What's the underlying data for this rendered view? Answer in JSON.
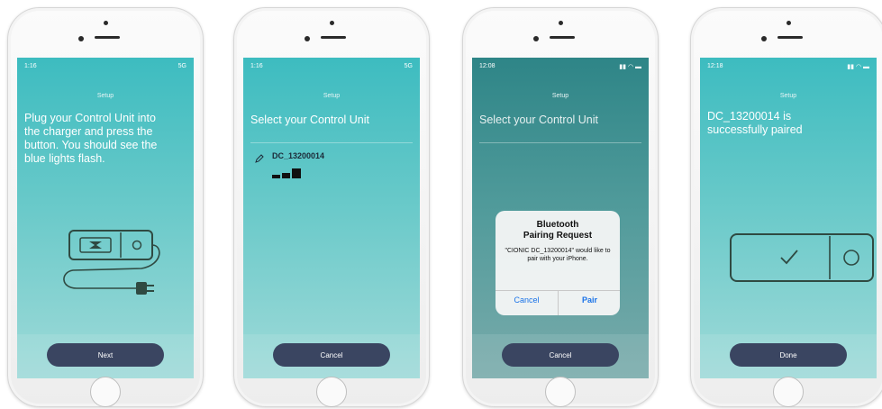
{
  "screens": [
    {
      "time": "1:16",
      "signal": "5G",
      "header": "Setup",
      "instruction": "Plug your Control Unit into the charger and press the button. You should see the blue lights flash.",
      "button": "Next"
    },
    {
      "time": "1:16",
      "signal": "5G",
      "header": "Setup",
      "title": "Select your Control Unit",
      "device_name": "DC_13200014",
      "button": "Cancel"
    },
    {
      "time": "12:08",
      "header": "Setup",
      "title": "Select your Control Unit",
      "alert": {
        "title_line1": "Bluetooth",
        "title_line2": "Pairing Request",
        "message": "\"CIONIC DC_13200014\" would like to pair with your iPhone.",
        "cancel": "Cancel",
        "pair": "Pair"
      },
      "button": "Cancel"
    },
    {
      "time": "12:18",
      "header": "Setup",
      "message": "DC_13200014 is successfully paired",
      "button": "Done"
    }
  ],
  "colors": {
    "button_bg": "#3a4561",
    "screen_top": "#3dbcc0",
    "screen_bottom": "#9fdad8",
    "line_art": "#2f4a42"
  },
  "icons": [
    "plug-device-illustration",
    "pencil-icon",
    "signal-bars-icon",
    "checkmark-device-illustration"
  ]
}
